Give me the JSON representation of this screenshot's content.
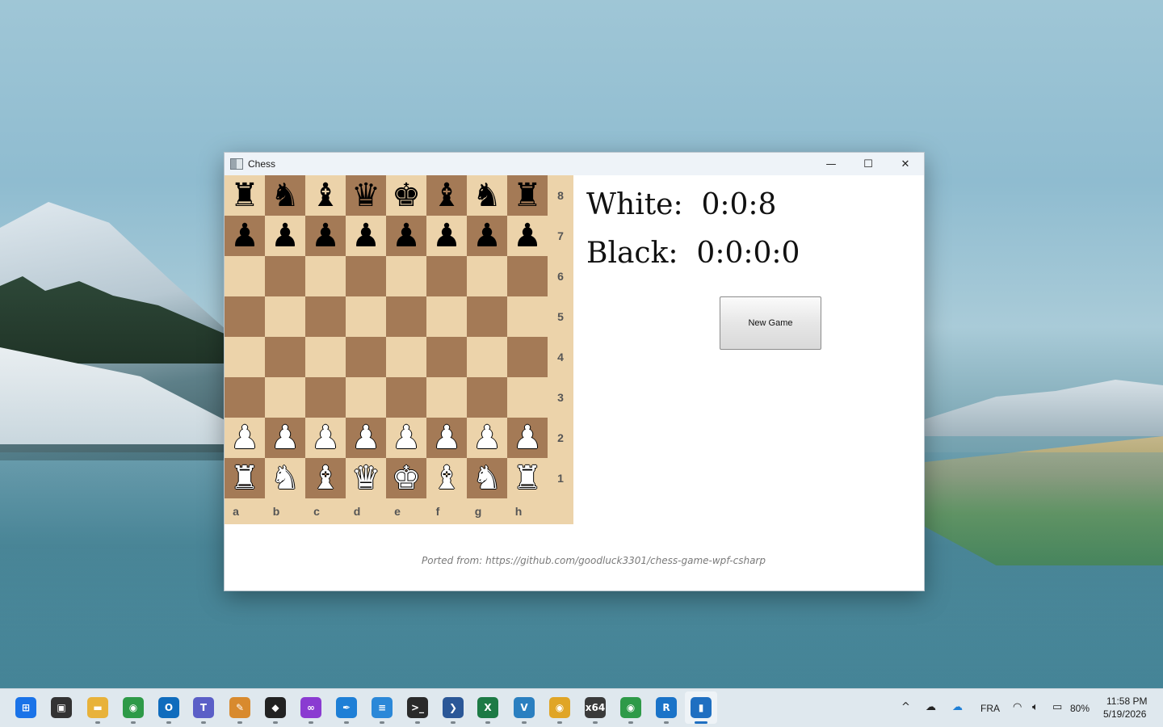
{
  "window": {
    "title": "Chess",
    "minimize_glyph": "—",
    "maximize_glyph": "☐",
    "close_glyph": "✕"
  },
  "board": {
    "ranks": [
      "8",
      "7",
      "6",
      "5",
      "4",
      "3",
      "2",
      "1"
    ],
    "files": [
      "a",
      "b",
      "c",
      "d",
      "e",
      "f",
      "g",
      "h"
    ],
    "rows": [
      [
        "♜",
        "♞",
        "♝",
        "♛",
        "♚",
        "♝",
        "♞",
        "♜"
      ],
      [
        "♟",
        "♟",
        "♟",
        "♟",
        "♟",
        "♟",
        "♟",
        "♟"
      ],
      [
        "",
        "",
        "",
        "",
        "",
        "",
        "",
        ""
      ],
      [
        "",
        "",
        "",
        "",
        "",
        "",
        "",
        ""
      ],
      [
        "",
        "",
        "",
        "",
        "",
        "",
        "",
        ""
      ],
      [
        "",
        "",
        "",
        "",
        "",
        "",
        "",
        ""
      ],
      [
        "♟",
        "♟",
        "♟",
        "♟",
        "♟",
        "♟",
        "♟",
        "♟"
      ],
      [
        "♜",
        "♞",
        "♝",
        "♛",
        "♚",
        "♝",
        "♞",
        "♜"
      ]
    ],
    "piece_colors": [
      [
        "black",
        "black",
        "black",
        "black",
        "black",
        "black",
        "black",
        "black"
      ],
      [
        "black",
        "black",
        "black",
        "black",
        "black",
        "black",
        "black",
        "black"
      ],
      [
        "",
        "",
        "",
        "",
        "",
        "",
        "",
        ""
      ],
      [
        "",
        "",
        "",
        "",
        "",
        "",
        "",
        ""
      ],
      [
        "",
        "",
        "",
        "",
        "",
        "",
        "",
        ""
      ],
      [
        "",
        "",
        "",
        "",
        "",
        "",
        "",
        ""
      ],
      [
        "white",
        "white",
        "white",
        "white",
        "white",
        "white",
        "white",
        "white"
      ],
      [
        "white",
        "white",
        "white",
        "white",
        "white",
        "white",
        "white",
        "white"
      ]
    ],
    "light_color": "#ecd3aa",
    "dark_color": "#a47a56"
  },
  "timers": {
    "white": "White:  0:0:8",
    "black": "Black:  0:0:0:0"
  },
  "new_game_label": "New Game",
  "credit": "Ported from: https://github.com/goodluck3301/chess-game-wpf-csharp",
  "taskbar": {
    "apps": [
      {
        "name": "start-icon",
        "glyph": "⊞",
        "color": "#1a73e8"
      },
      {
        "name": "task-view-icon",
        "glyph": "▣",
        "color": "#333333"
      },
      {
        "name": "file-explorer-icon",
        "glyph": "▬",
        "color": "#e8b23a"
      },
      {
        "name": "chrome-icon",
        "glyph": "◉",
        "color": "#2e9a48"
      },
      {
        "name": "outlook-icon",
        "glyph": "O",
        "color": "#0f6cbd"
      },
      {
        "name": "teams-icon",
        "glyph": "T",
        "color": "#5b5fc7"
      },
      {
        "name": "paint-icon",
        "glyph": "✎",
        "color": "#d88a2e"
      },
      {
        "name": "app-black-icon",
        "glyph": "◆",
        "color": "#222222"
      },
      {
        "name": "visual-studio-icon",
        "glyph": "∞",
        "color": "#8a3bd1"
      },
      {
        "name": "pen-app-icon",
        "glyph": "✒",
        "color": "#1e7fd6"
      },
      {
        "name": "notepad-icon",
        "glyph": "≡",
        "color": "#2b88d8"
      },
      {
        "name": "terminal-icon",
        "glyph": ">_",
        "color": "#2a2a2a"
      },
      {
        "name": "powershell-icon",
        "glyph": "❯",
        "color": "#2b5797"
      },
      {
        "name": "excel-icon",
        "glyph": "X",
        "color": "#1d7a45"
      },
      {
        "name": "vs-code-icon",
        "glyph": "V",
        "color": "#2a7fc0"
      },
      {
        "name": "chrome-profile-icon",
        "glyph": "◉",
        "color": "#e0a526"
      },
      {
        "name": "x64-app-icon",
        "glyph": "x64",
        "color": "#3a3a3a"
      },
      {
        "name": "chrome-alt-icon",
        "glyph": "◉",
        "color": "#2e9a48"
      },
      {
        "name": "rider-icon",
        "glyph": "R",
        "color": "#1a73c8"
      },
      {
        "name": "chess-app-icon",
        "glyph": "▮",
        "color": "#1f6fc1"
      }
    ],
    "tray": {
      "chevron": "^",
      "language": "FRA",
      "battery": "80%",
      "time": "11:58 PM",
      "date": "5/19/2026"
    }
  }
}
